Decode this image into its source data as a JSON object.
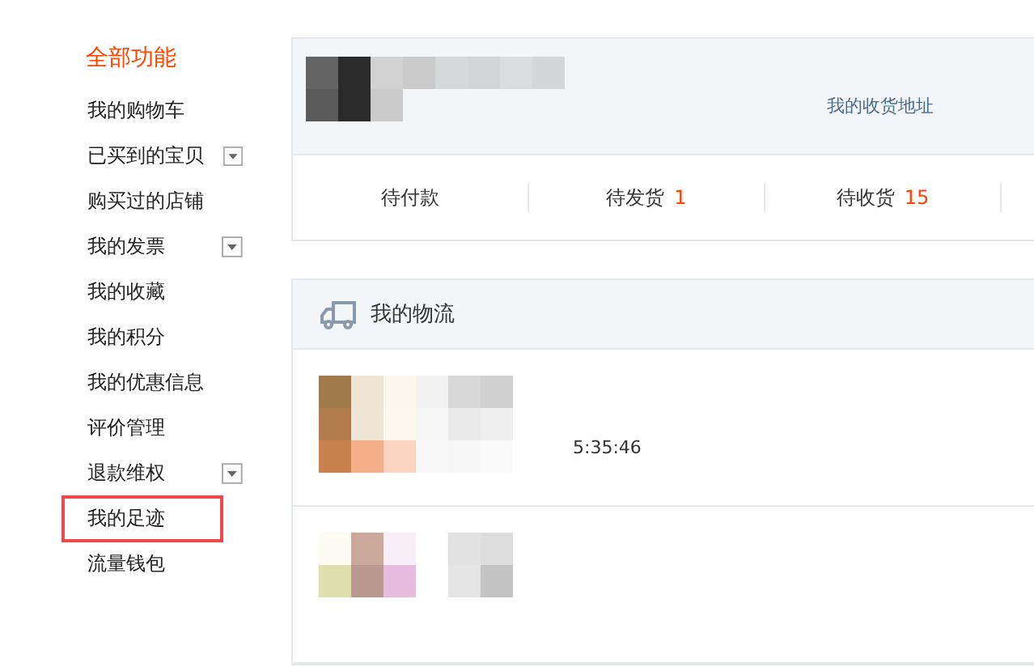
{
  "sidebar": {
    "title": "全部功能",
    "items": [
      {
        "label": "我的购物车",
        "dropdown": false,
        "highlighted": false
      },
      {
        "label": "已买到的宝贝",
        "dropdown": true,
        "highlighted": false
      },
      {
        "label": "购买过的店铺",
        "dropdown": false,
        "highlighted": false
      },
      {
        "label": "我的发票",
        "dropdown": true,
        "highlighted": false
      },
      {
        "label": "我的收藏",
        "dropdown": false,
        "highlighted": false
      },
      {
        "label": "我的积分",
        "dropdown": false,
        "highlighted": false
      },
      {
        "label": "我的优惠信息",
        "dropdown": false,
        "highlighted": false
      },
      {
        "label": "评价管理",
        "dropdown": false,
        "highlighted": false
      },
      {
        "label": "退款维权",
        "dropdown": true,
        "highlighted": false
      },
      {
        "label": "我的足迹",
        "dropdown": false,
        "highlighted": true
      },
      {
        "label": "流量钱包",
        "dropdown": false,
        "highlighted": false
      }
    ]
  },
  "profile": {
    "address_link": "我的收货地址"
  },
  "order_tabs": [
    {
      "label": "待付款"
    },
    {
      "label": "待发货",
      "count": "1"
    },
    {
      "label": "待收货",
      "count": "15"
    }
  ],
  "logistics": {
    "title": "我的物流",
    "rows": [
      {
        "time": "5:35:46"
      },
      {}
    ]
  }
}
